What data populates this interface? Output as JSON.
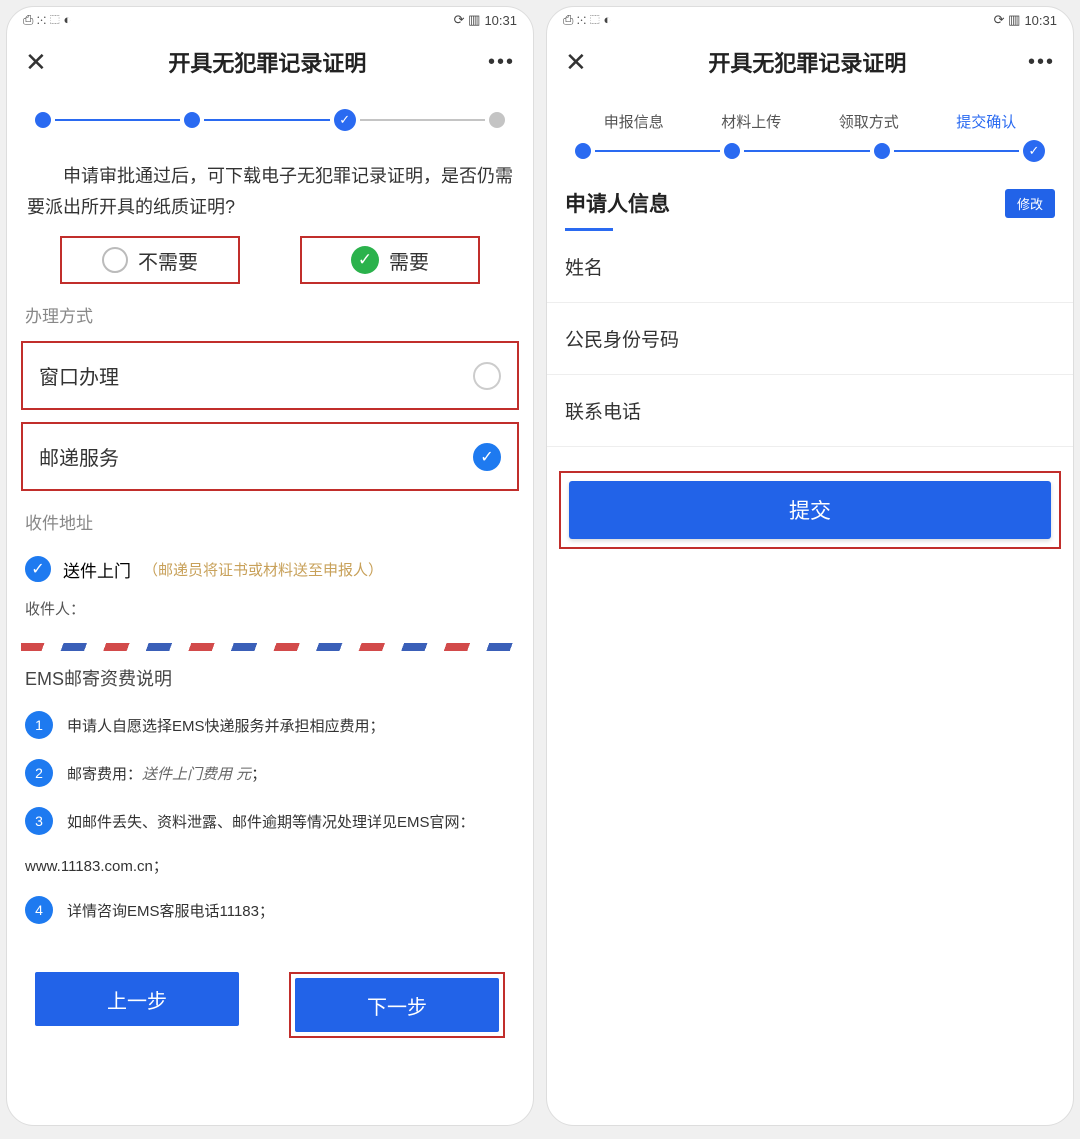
{
  "status": {
    "left_icons": "⎙ ⁙ ⬚ ◐",
    "right_icons": "⟳ ▥",
    "time": "10:31"
  },
  "nav": {
    "title": "开具无犯罪记录证明",
    "close": "✕",
    "more": "•••"
  },
  "left": {
    "prompt": "申请审批通过后，可下载电子无犯罪记录证明，是否仍需要派出所开具的纸质证明?",
    "choice_no": "不需要",
    "choice_yes": "需要",
    "handle_title": "办理方式",
    "opt_window": "窗口办理",
    "opt_mail": "邮递服务",
    "addr_title": "收件地址",
    "door_deliver": "送件上门",
    "door_hint": "（邮递员将证书或材料送至申报人）",
    "recipient_label": "收件人：",
    "ems_title": "EMS邮寄资费说明",
    "ems_items": [
      "申请人自愿选择EMS快递服务并承担相应费用；",
      "邮寄费用：送件上门费用  元；",
      "如邮件丢失、资料泄露、邮件逾期等情况处理详见EMS官网：",
      "详情咨询EMS客服电话11183；"
    ],
    "ems_url": "www.11183.com.cn；",
    "prev": "上一步",
    "next": "下一步"
  },
  "right": {
    "steps": [
      "申报信息",
      "材料上传",
      "领取方式",
      "提交确认"
    ],
    "info_title": "申请人信息",
    "edit": "修改",
    "field_name": "姓名",
    "field_id": "公民身份号码",
    "field_phone": "联系电话",
    "submit": "提交"
  }
}
